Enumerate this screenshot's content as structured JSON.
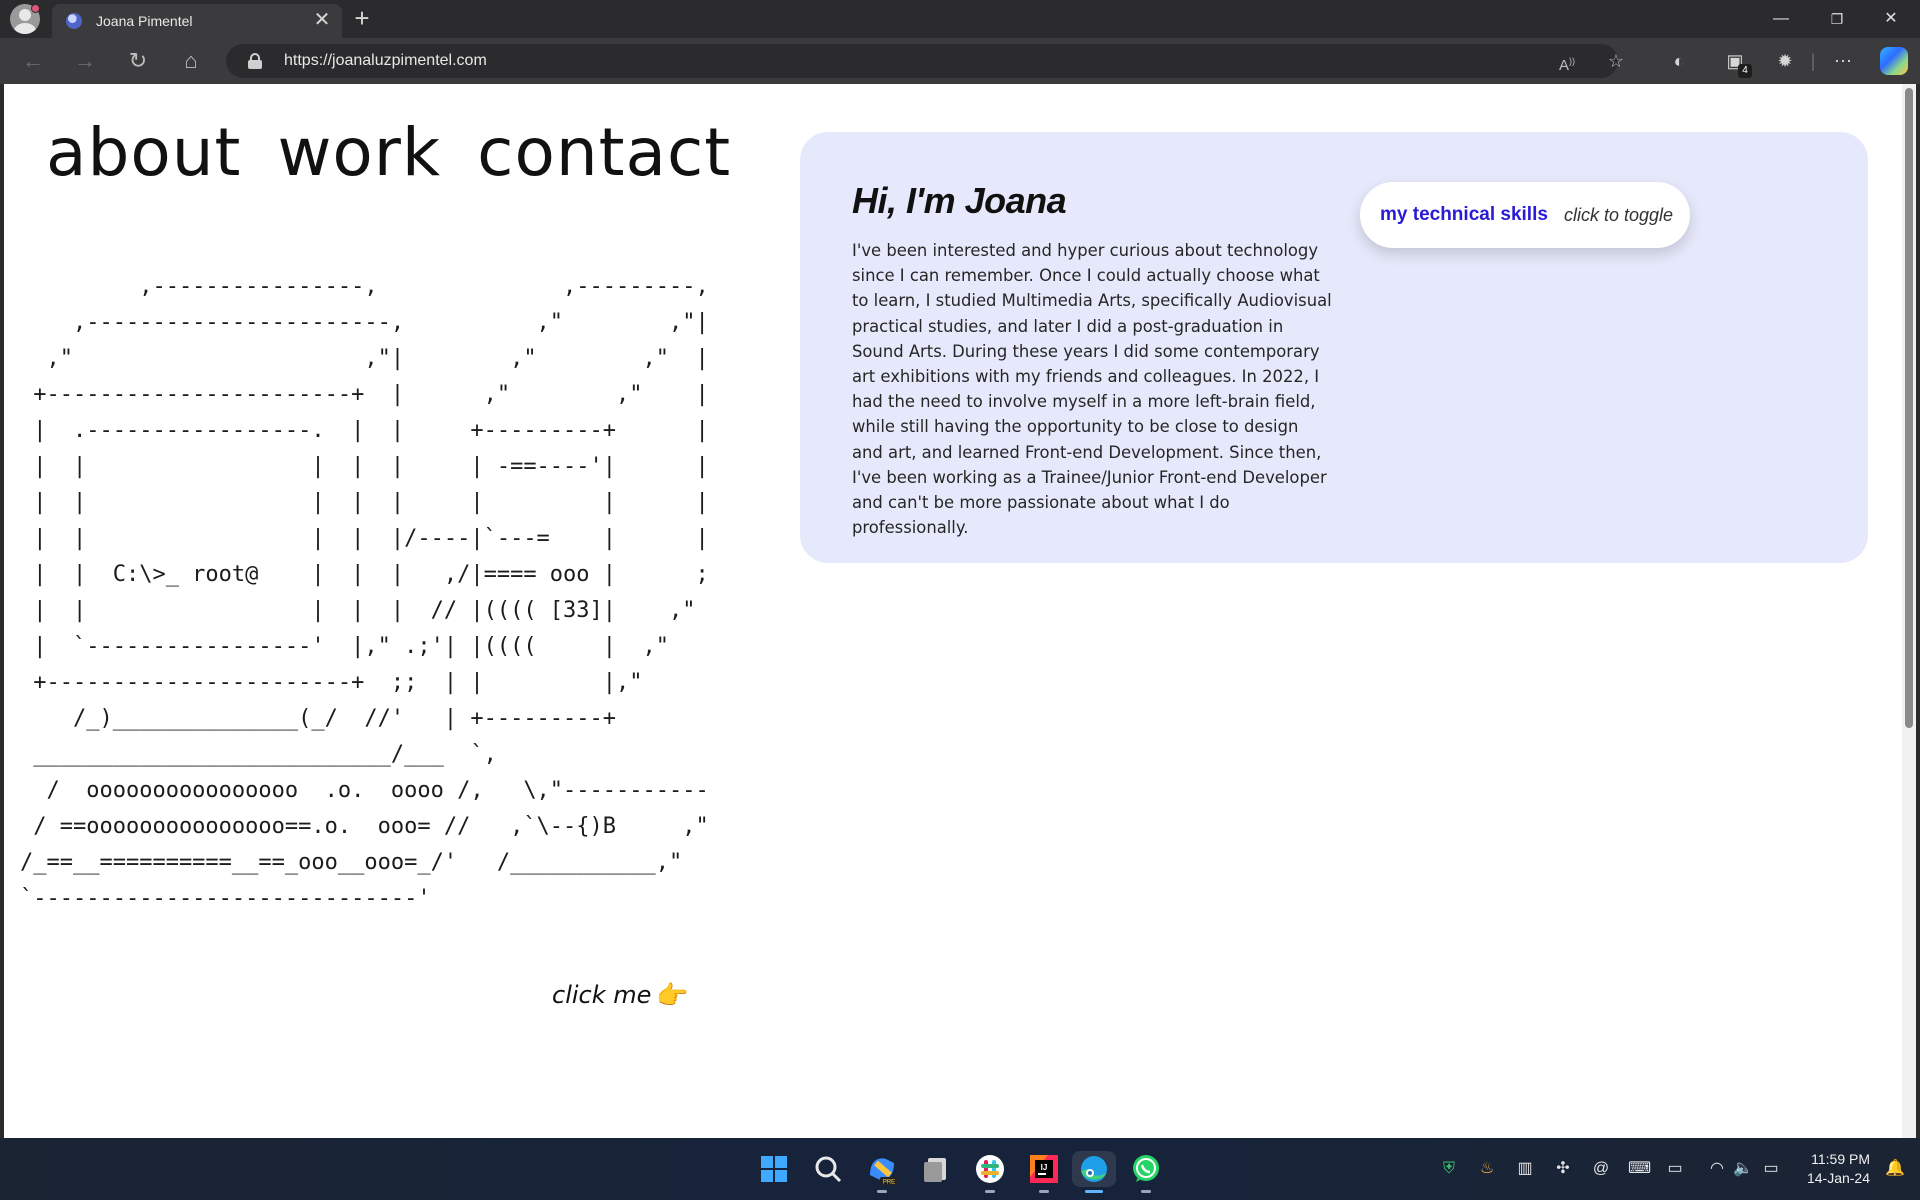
{
  "browser": {
    "tab_title": "Joana Pimentel",
    "tab_close": "✕",
    "new_tab": "+",
    "url": "https://joanaluzpimentel.com",
    "window_controls": {
      "minimize": "—",
      "restore": "❐",
      "close": "✕"
    },
    "read_aloud": "A̩",
    "extension_badge": "4"
  },
  "page": {
    "nav": {
      "about": "about",
      "work": "work",
      "contact": "contact"
    },
    "ascii_art": "         ,----------------,              ,---------,\n    ,-----------------------,          ,\"        ,\"|\n  ,\"                      ,\"|        ,\"        ,\"  |\n +-----------------------+  |      ,\"        ,\"    |\n |  .-----------------.  |  |     +---------+      |\n |  |                 |  |  |     | -==----'|      |\n |  |                 |  |  |     |         |      |\n |  |                 |  |  |/----|`---=    |      |\n |  |  C:\\>_ root@    |  |  |   ,/|==== ooo |      ;\n |  |                 |  |  |  // |(((( [33]|    ,\"\n |  `-----------------'  |,\" .;'| |((((     |  ,\"\n +-----------------------+  ;;  | |         |,\"\n    /_)______________(_/  //'   | +---------+\n ___________________________/___  `,\n  /  oooooooooooooooo  .o.  oooo /,   \\,\"-----------\n / ==ooooooooooooooo==.o.  ooo= //   ,`\\--{)B     ,\"\n/_==__==========__==_ooo__ooo=_/'   /___________,\"\n`-----------------------------'",
    "click_me": "click me",
    "hand_icon": "👉",
    "about_card": {
      "title": "Hi, I'm Joana",
      "body": "I've been interested and hyper curious about technology since I can remember. Once I could actually choose what to learn, I studied Multimedia Arts, specifically Audiovisual practical studies, and later I did a post-graduation in Sound Arts. During these years I did some contemporary art exhibitions with my friends and colleagues. In 2022, I had the need to involve myself in a more left-brain field, while still having the opportunity to be close to design and art, and learned Front-end Development. Since then, I've been working as a Trainee/Junior Front-end Developer and can't be more passionate about what I do professionally.",
      "skills_label": "my technical skills",
      "skills_hint": "click to toggle"
    }
  },
  "taskbar": {
    "time": "11:59 PM",
    "date": "14-Jan-24"
  },
  "colors": {
    "card_bg": "#e6e9fb",
    "skills_text": "#2a1bd6",
    "browser_chrome": "#3b3b3d"
  }
}
